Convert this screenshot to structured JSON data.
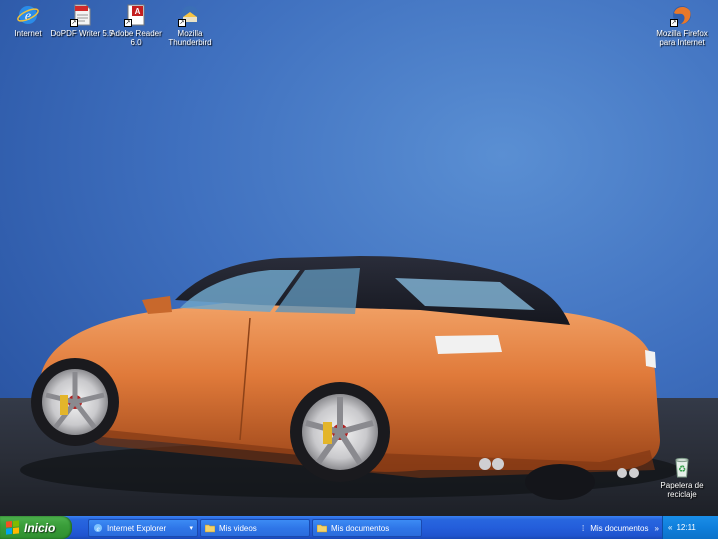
{
  "desktop": {
    "icons": [
      {
        "label": "Internet",
        "icon": "internet-explorer-icon"
      },
      {
        "label": "DoPDF Writer 5.5",
        "icon": "pdf-document-icon"
      },
      {
        "label": "Adobe Reader 6.0",
        "icon": "adobe-reader-icon"
      },
      {
        "label": "Mozilla Thunderbird",
        "icon": "thunderbird-icon"
      },
      {
        "label": "Mozilla Firefox para Internet",
        "icon": "firefox-icon"
      },
      {
        "label": "Papelera de reciclaje",
        "icon": "recycle-bin-icon"
      }
    ],
    "wallpaper": "Orange convertible car on blue background"
  },
  "taskbar": {
    "start_label": "Inicio",
    "buttons": [
      {
        "label": "Internet Explorer",
        "icon": "internet-explorer-icon"
      },
      {
        "label": "Mis videos",
        "icon": "folder-icon"
      },
      {
        "label": "Mis documentos",
        "icon": "folder-icon"
      }
    ],
    "toolbar_label": "Mis documentos",
    "clock": "12:11"
  },
  "colors": {
    "taskbar_blue": "#245edb",
    "start_green": "#3a9e3a",
    "tray_blue": "#0f7fdc",
    "wallpaper_blue": "#3f70bf",
    "car_orange": "#e07a3a"
  }
}
